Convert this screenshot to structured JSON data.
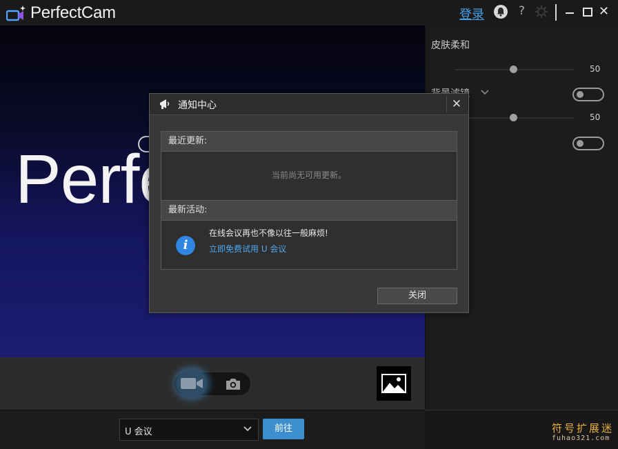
{
  "app": {
    "title": "PerfectCam",
    "login_label": "登录",
    "help_label": "?",
    "close_label": "✕"
  },
  "preview": {
    "brand_text": "Perfec"
  },
  "settings": {
    "skin_label": "皮肤柔和",
    "skin_value": "50",
    "skin_level": 0.5,
    "background_label": "背景滤镜",
    "background_value": "50",
    "background_level": 0.5
  },
  "capture": {
    "mode_video_icon": "video-camera-icon",
    "mode_photo_icon": "camera-icon",
    "gallery_icon": "image-icon"
  },
  "bottom": {
    "dropdown_value": "U 会议",
    "go_label": "前往"
  },
  "watermark": {
    "cn": "符号扩展迷",
    "en": "fuhao321.com"
  },
  "dialog": {
    "title": "通知中心",
    "close_x": "✕",
    "updates_header": "最近更新:",
    "updates_empty": "当前尚无可用更新。",
    "activity_header": "最新活动:",
    "activity_text": "在线会议再也不像以往一般麻烦!",
    "activity_link": "立即免费试用 U 会议",
    "close_button": "关闭"
  },
  "colors": {
    "accent": "#3c8fcc",
    "link": "#4fa7ee",
    "watermark": "#e8b13a"
  }
}
